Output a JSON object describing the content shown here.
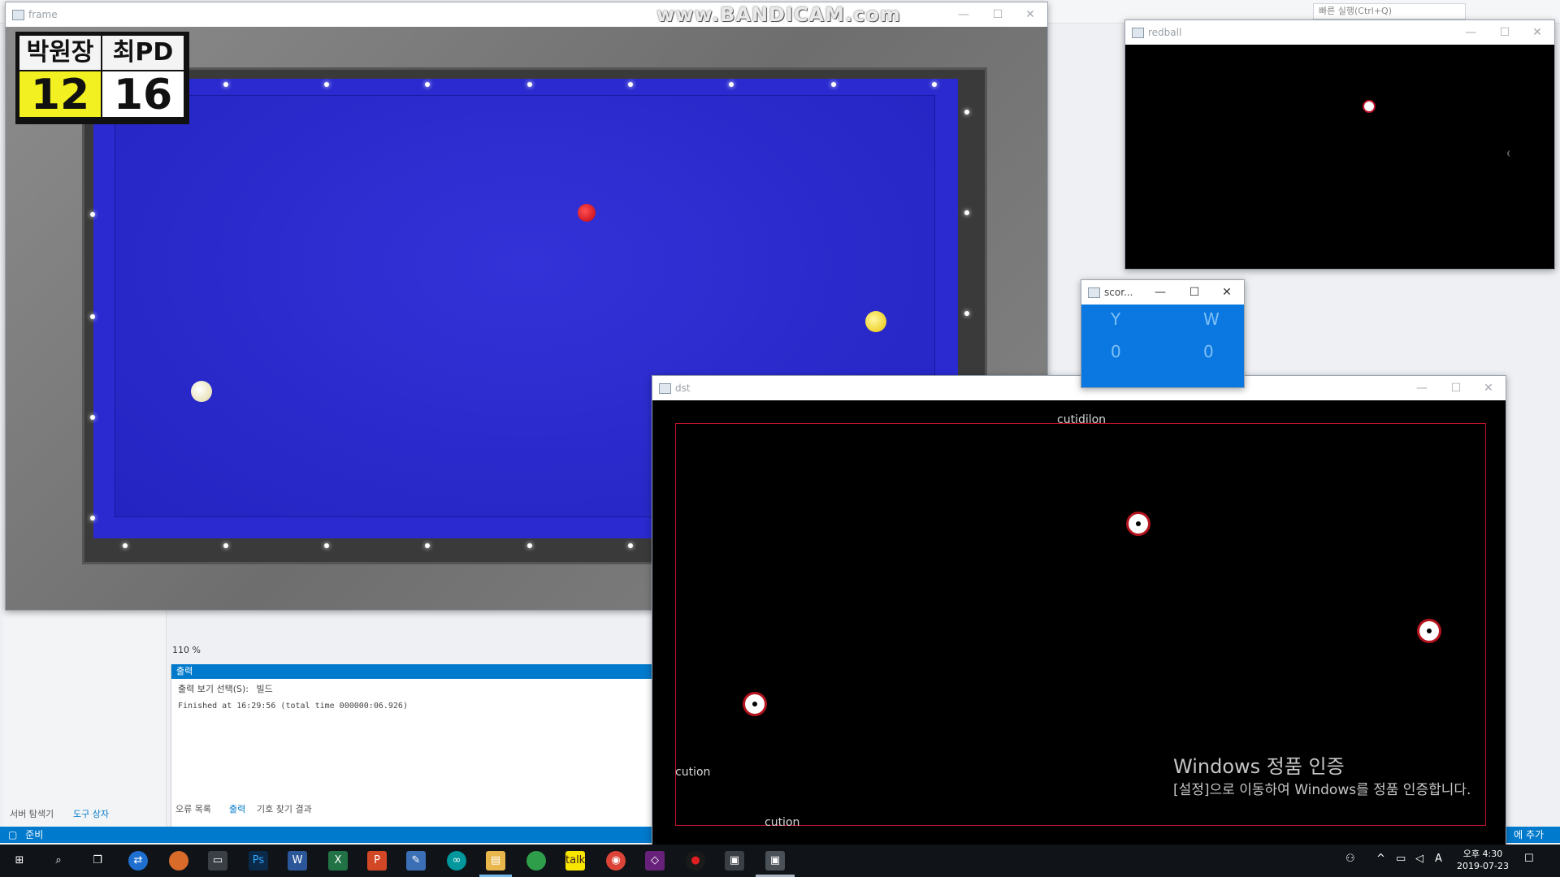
{
  "ide": {
    "quick_launch": "빠른 실행(Ctrl+Q)",
    "output_header": "출력",
    "output_select_label": "출력 보기 선택(S):",
    "output_select_value": "빌드",
    "output_line": "Finished at 16:29:56 (total time 000000:06.926)",
    "zoom": "110 %",
    "bottom_tabs": [
      "오류 목록",
      "출력",
      "기호 찾기 결과"
    ],
    "left_tabs": [
      "서버 탐색기",
      "도구 상자"
    ],
    "status": "준비",
    "status_right": "에 추가"
  },
  "frame_window": {
    "title": "frame",
    "scoreboard": {
      "players": [
        "박원장",
        "최PD"
      ],
      "scores": [
        "12",
        "16"
      ]
    }
  },
  "bandicam_watermark": "www.BANDICAM.com",
  "redball_window": {
    "title": "redball"
  },
  "score_window": {
    "title": "scor...",
    "labels": [
      "Y",
      "W"
    ],
    "values": [
      "0",
      "0"
    ]
  },
  "dst_window": {
    "title": "dst",
    "top_text": "cutidilon",
    "left_text": "cution",
    "bottom_text": "cution"
  },
  "activation": {
    "line1": "Windows 정품 인증",
    "line2": "[설정]으로 이동하여 Windows를 정품 인증합니다."
  },
  "taskbar": {
    "apps": [
      "windows-start-icon",
      "search-icon",
      "task-view-icon",
      "teamviewer-icon",
      "bird-app-icon",
      "monitor-app-icon",
      "photoshop-icon",
      "word-icon",
      "excel-icon",
      "powerpoint-icon",
      "tool-app-icon",
      "arduino-icon",
      "file-explorer-icon",
      "green-app-icon",
      "kakaotalk-icon",
      "chrome-icon",
      "visual-studio-icon",
      "record-icon",
      "window-app-icon",
      "active-window-icon"
    ],
    "clock_time": "오후 4:30",
    "clock_date": "2019-07-23",
    "ime": "A"
  },
  "colors": {
    "table_blue": "#2a2ad0",
    "score_bg": "#0a78e0",
    "frame_red": "#c0142a",
    "accent": "#007acc"
  }
}
